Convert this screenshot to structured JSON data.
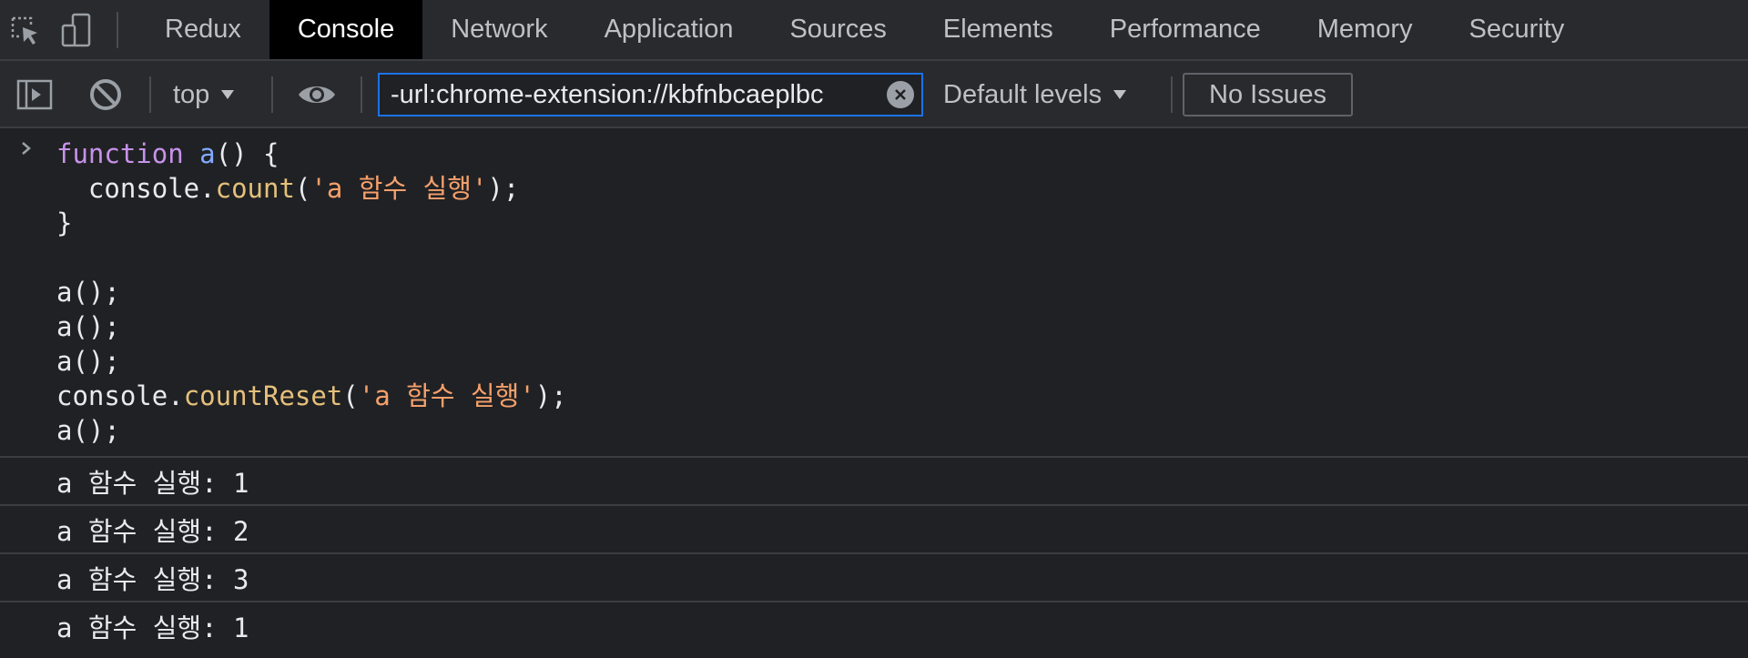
{
  "devtools": {
    "tabs": [
      {
        "label": "Redux"
      },
      {
        "label": "Console"
      },
      {
        "label": "Network"
      },
      {
        "label": "Application"
      },
      {
        "label": "Sources"
      },
      {
        "label": "Elements"
      },
      {
        "label": "Performance"
      },
      {
        "label": "Memory"
      },
      {
        "label": "Security"
      }
    ],
    "active_tab": "Console",
    "icons": [
      "inspect-element-icon",
      "device-toolbar-icon"
    ]
  },
  "toolbar": {
    "context": "top",
    "filter_value": "-url:chrome-extension://kbfnbcaeplbc",
    "levels": "Default levels",
    "issues": "No Issues",
    "icons": [
      "sidebar-toggle-icon",
      "clear-console-icon",
      "live-expression-eye-icon",
      "clear-filter-icon"
    ]
  },
  "console": {
    "code": {
      "l1_kw": "function",
      "l1_fn": "a",
      "l1_rest": "() {",
      "l2_pre": "  console.",
      "l2_method": "count",
      "l2_open": "(",
      "l2_str": "'a 함수 실행'",
      "l2_close": ");",
      "l3": "}",
      "l5": "a();",
      "l6": "a();",
      "l7": "a();",
      "l8_pre": "console.",
      "l8_method": "countReset",
      "l8_open": "(",
      "l8_str": "'a 함수 실행'",
      "l8_close": ");",
      "l9": "a();"
    },
    "outputs": [
      "a 함수 실행: 1",
      "a 함수 실행: 2",
      "a 함수 실행: 3",
      "a 함수 실행: 1"
    ]
  },
  "colors": {
    "background": "#202124",
    "panel": "#292a2d",
    "active_tab": "#000000",
    "keyword": "#c792ea",
    "function_name": "#82aaff",
    "string": "#f5a06b",
    "method": "#e5c07b",
    "focus_border": "#1a73e8"
  }
}
